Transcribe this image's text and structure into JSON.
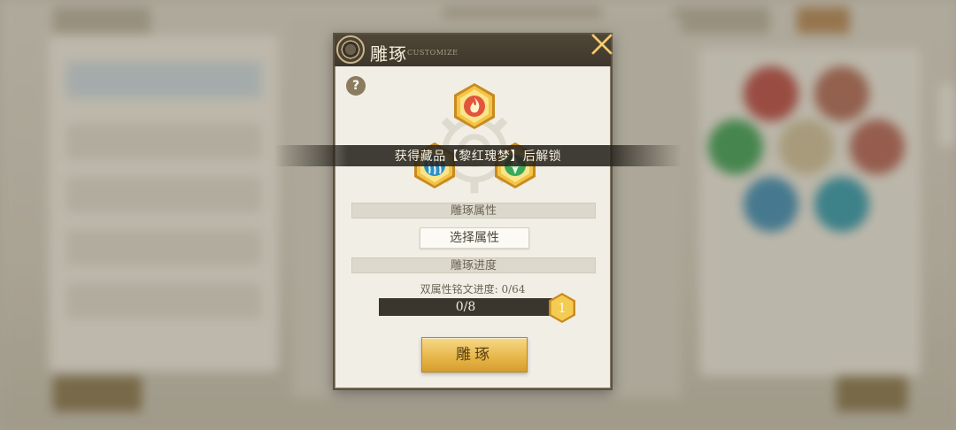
{
  "modal": {
    "title": "雕琢",
    "subtitle": "CUSTOMIZE",
    "help_label": "?",
    "unlock_notice": "获得藏品【黎红瑰梦】后解锁",
    "attributes_header": "雕琢属性",
    "select_attribute_label": "选择属性",
    "progress_header": "雕琢进度",
    "dual_progress_label": "双属性铭文进度: 0/64",
    "progress": {
      "text": "0/8",
      "current": 0,
      "total": 8
    },
    "badge_number": "1",
    "carve_button_label": "雕琢"
  },
  "icons": {
    "top": "fire-element-icon",
    "left": "water-element-icon",
    "right": "nature-element-icon"
  },
  "colors": {
    "gold": "#e8b84c",
    "header_dark": "#3e372b",
    "panel_bg": "#f1eee5",
    "fire": "#e2553a",
    "water": "#2f8fc4",
    "nature": "#3ba85a"
  }
}
